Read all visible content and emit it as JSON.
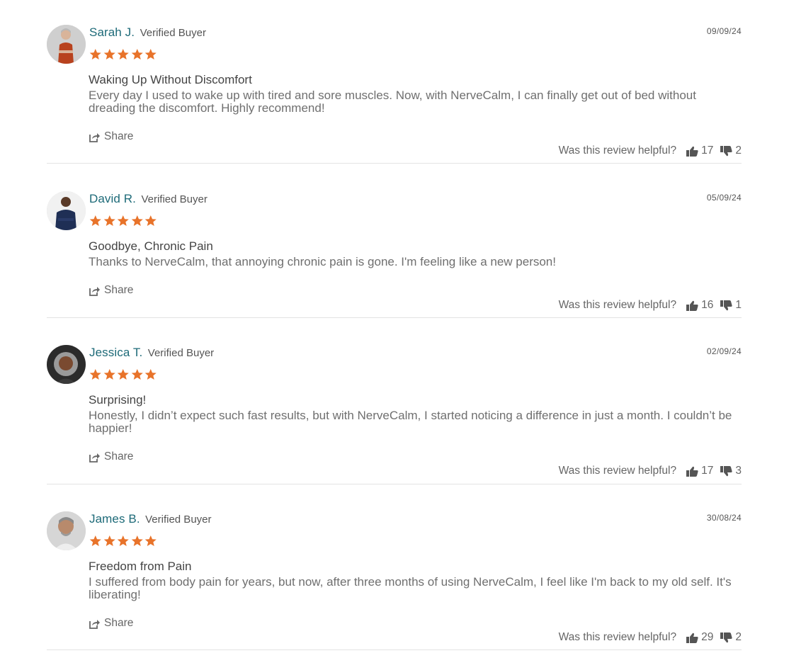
{
  "colors": {
    "name": "#1d6a78",
    "star": "#e8732a",
    "text": "#6f6f6f",
    "divider": "#e3e3e3"
  },
  "helpful_prompt": "Was this review helpful?",
  "share_label": "Share",
  "reviews": [
    {
      "name": "Sarah J.",
      "badge": "Verified Buyer",
      "date": "09/09/24",
      "rating": 5,
      "title": "Waking Up Without Discomfort",
      "body": "Every day I used to wake up with tired and sore muscles. Now, with NerveCalm, I can finally get out of bed without dreading the discomfort. Highly recommend!",
      "up": "17",
      "down": "2",
      "avatar_icon": "woman-portrait-icon"
    },
    {
      "name": "David R.",
      "badge": "Verified Buyer",
      "date": "05/09/24",
      "rating": 5,
      "title": "Goodbye, Chronic Pain",
      "body": "Thanks to NerveCalm, that annoying chronic pain is gone. I'm feeling like a new person!",
      "up": "16",
      "down": "1",
      "avatar_icon": "man-portrait-icon"
    },
    {
      "name": "Jessica T.",
      "badge": "Verified Buyer",
      "date": "02/09/24",
      "rating": 5,
      "title": "Surprising!",
      "body": "Honestly, I didn’t expect such fast results, but with NerveCalm, I started noticing a difference in just a month. I couldn’t be happier!",
      "up": "17",
      "down": "3",
      "avatar_icon": "woman-portrait-icon"
    },
    {
      "name": "James B.",
      "badge": "Verified Buyer",
      "date": "30/08/24",
      "rating": 5,
      "title": "Freedom from Pain",
      "body": "I suffered from body pain for years, but now, after three months of using NerveCalm, I feel like I'm back to my old self. It's liberating!",
      "up": "29",
      "down": "2",
      "avatar_icon": "man-portrait-icon"
    }
  ]
}
